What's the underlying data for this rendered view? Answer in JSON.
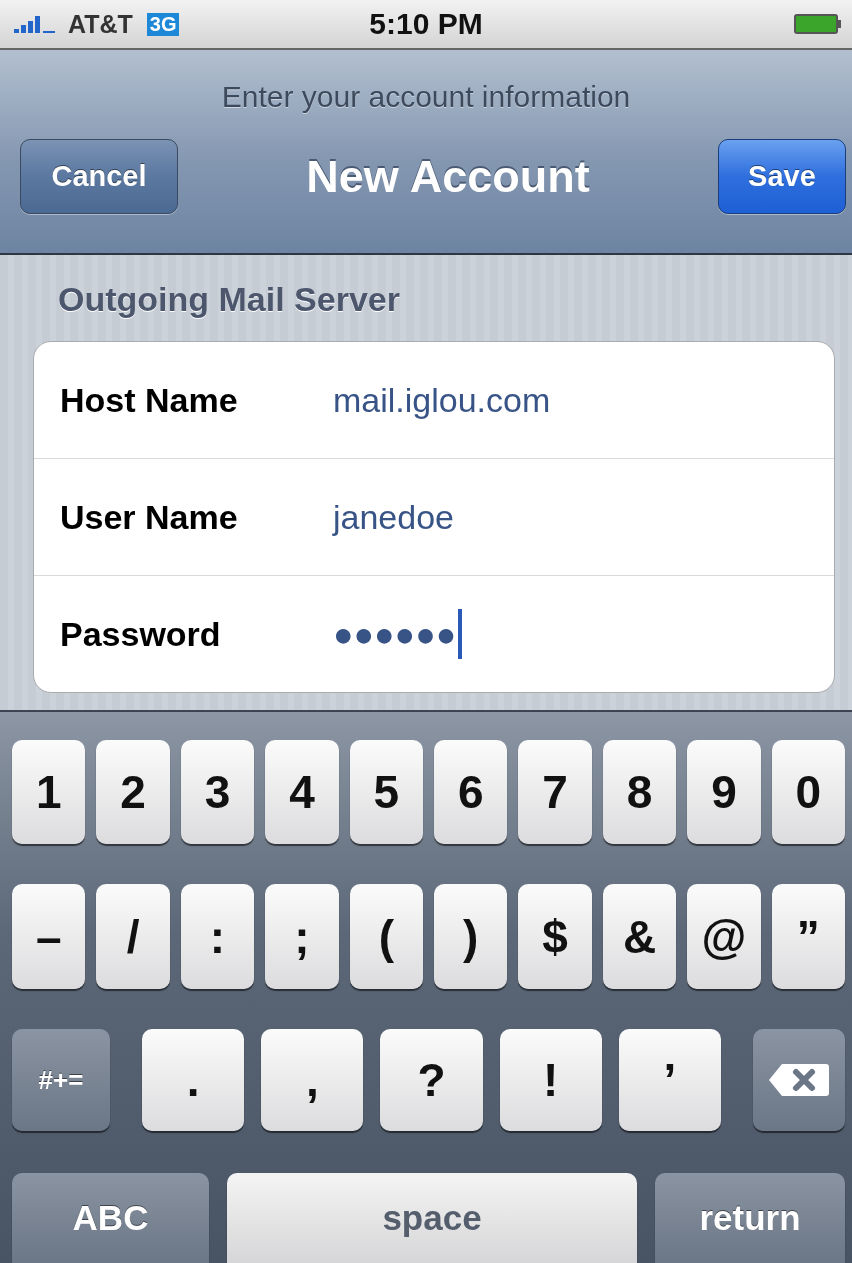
{
  "status_bar": {
    "carrier": "AT&T",
    "network": "3G",
    "time": "5:10 PM"
  },
  "nav_bar": {
    "prompt": "Enter your account information",
    "title": "New Account",
    "left_button": "Cancel",
    "right_button": "Save"
  },
  "section_header": "Outgoing Mail Server",
  "fields": [
    {
      "label": "Host Name",
      "value": "mail.iglou.com",
      "focused": false
    },
    {
      "label": "User Name",
      "value": "janedoe",
      "focused": false
    },
    {
      "label": "Password",
      "value": "●●●●●●",
      "focused": true
    }
  ],
  "keyboard": {
    "rows": [
      {
        "keys": [
          {
            "kind": "char",
            "label": "1"
          },
          {
            "kind": "char",
            "label": "2"
          },
          {
            "kind": "char",
            "label": "3"
          },
          {
            "kind": "char",
            "label": "4"
          },
          {
            "kind": "char",
            "label": "5"
          },
          {
            "kind": "char",
            "label": "6"
          },
          {
            "kind": "char",
            "label": "7"
          },
          {
            "kind": "char",
            "label": "8"
          },
          {
            "kind": "char",
            "label": "9"
          },
          {
            "kind": "char",
            "label": "0"
          }
        ]
      },
      {
        "keys": [
          {
            "kind": "char",
            "label": "–"
          },
          {
            "kind": "char",
            "label": "/"
          },
          {
            "kind": "char",
            "label": ":"
          },
          {
            "kind": "char",
            "label": ";"
          },
          {
            "kind": "char",
            "label": "("
          },
          {
            "kind": "char",
            "label": ")"
          },
          {
            "kind": "char",
            "label": "$"
          },
          {
            "kind": "char",
            "label": "&"
          },
          {
            "kind": "char",
            "label": "@"
          },
          {
            "kind": "char",
            "label": "”"
          }
        ]
      },
      {
        "keys": [
          {
            "kind": "function",
            "label": "#+="
          },
          {
            "kind": "char",
            "label": "."
          },
          {
            "kind": "char",
            "label": ","
          },
          {
            "kind": "char",
            "label": "?"
          },
          {
            "kind": "char",
            "label": "!"
          },
          {
            "kind": "char",
            "label": "’"
          },
          {
            "kind": "delete"
          }
        ]
      },
      {
        "keys": [
          {
            "kind": "function",
            "label": "ABC"
          },
          {
            "kind": "space",
            "label": "space"
          },
          {
            "kind": "function",
            "label": "return"
          }
        ]
      }
    ]
  }
}
